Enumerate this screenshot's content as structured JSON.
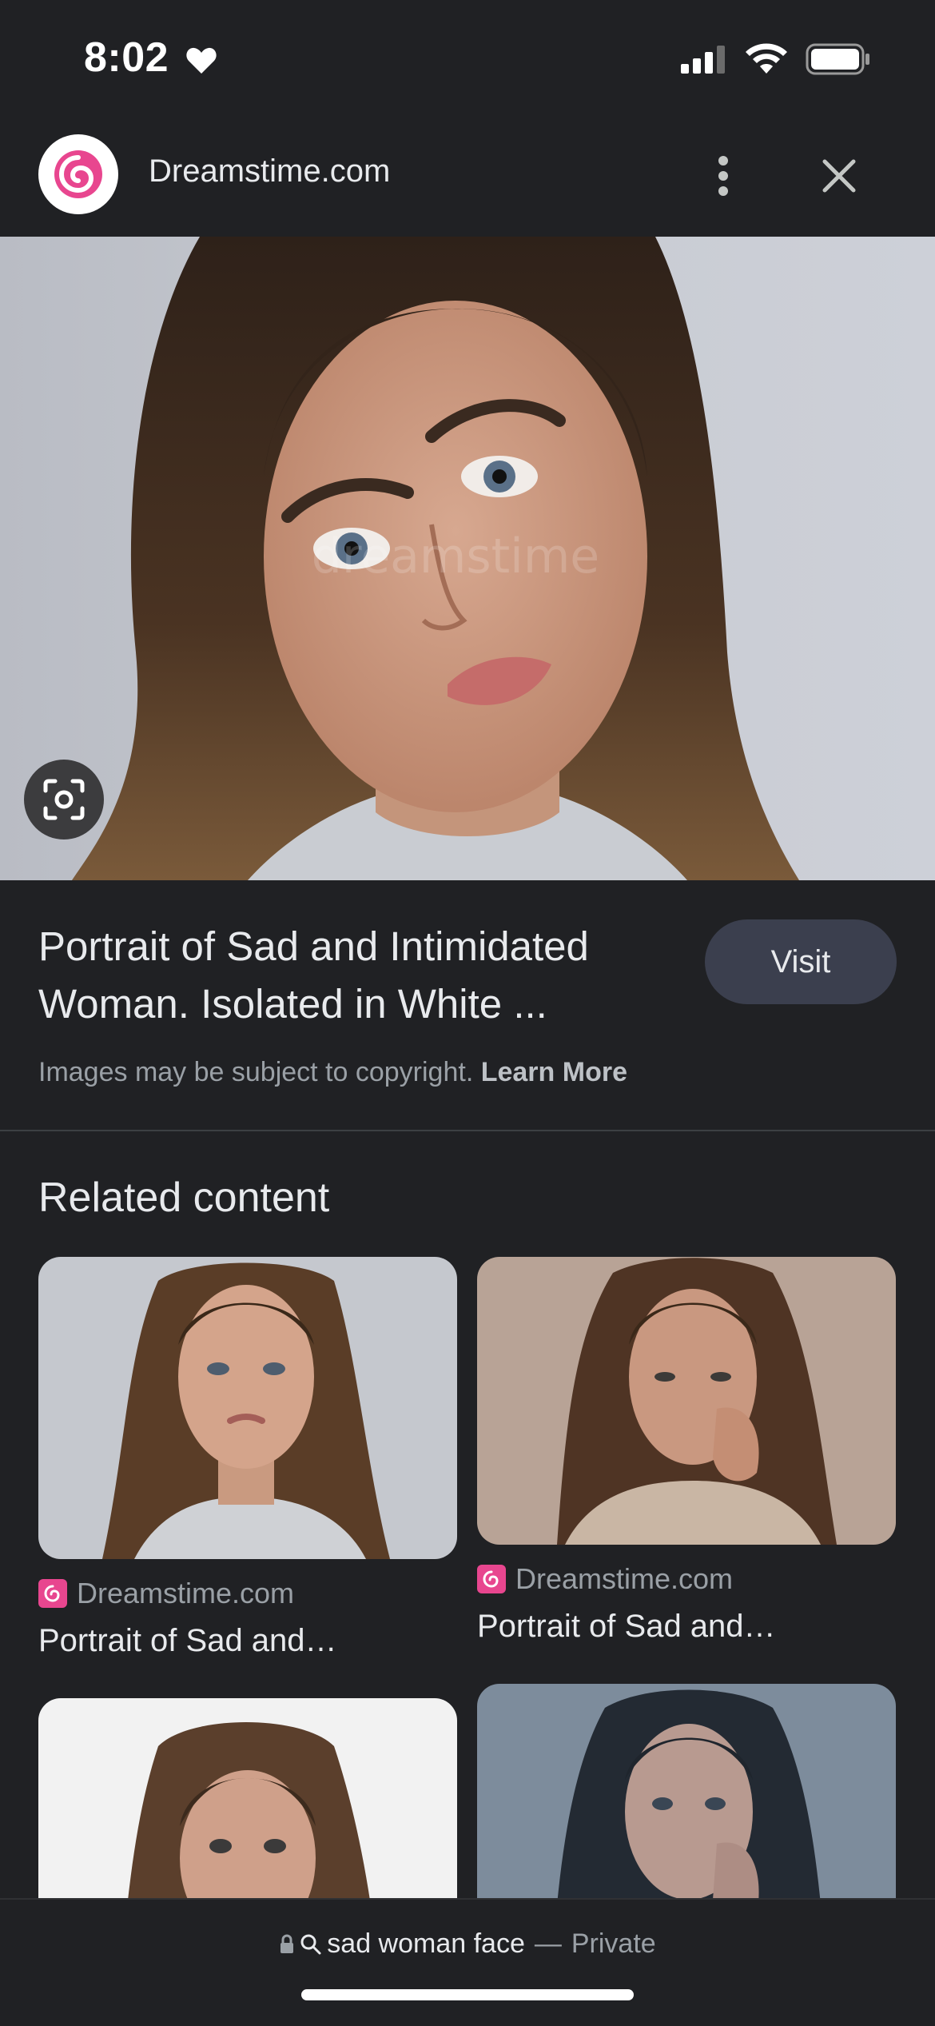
{
  "status": {
    "time": "8:02"
  },
  "header": {
    "site_name": "Dreamstime.com"
  },
  "main": {
    "title": "Portrait of Sad and Intimidated Woman. Isolated in White ...",
    "visit_label": "Visit",
    "copyright_text": "Images may be subject to copyright.",
    "learn_more_label": "Learn More"
  },
  "related": {
    "heading": "Related content",
    "cards": [
      {
        "source": "Dreamstime.com",
        "title": "Portrait of Sad and…"
      },
      {
        "source": "Dreamstime.com",
        "title": "Portrait of Sad and…"
      },
      {
        "source": "",
        "title": ""
      },
      {
        "source": "",
        "title": ""
      }
    ]
  },
  "bottom": {
    "query": "sad woman face",
    "separator": "—",
    "mode": "Private"
  },
  "colors": {
    "background": "#202124",
    "visit_button": "#3b3f4e",
    "brand_pink": "#e8468f"
  }
}
